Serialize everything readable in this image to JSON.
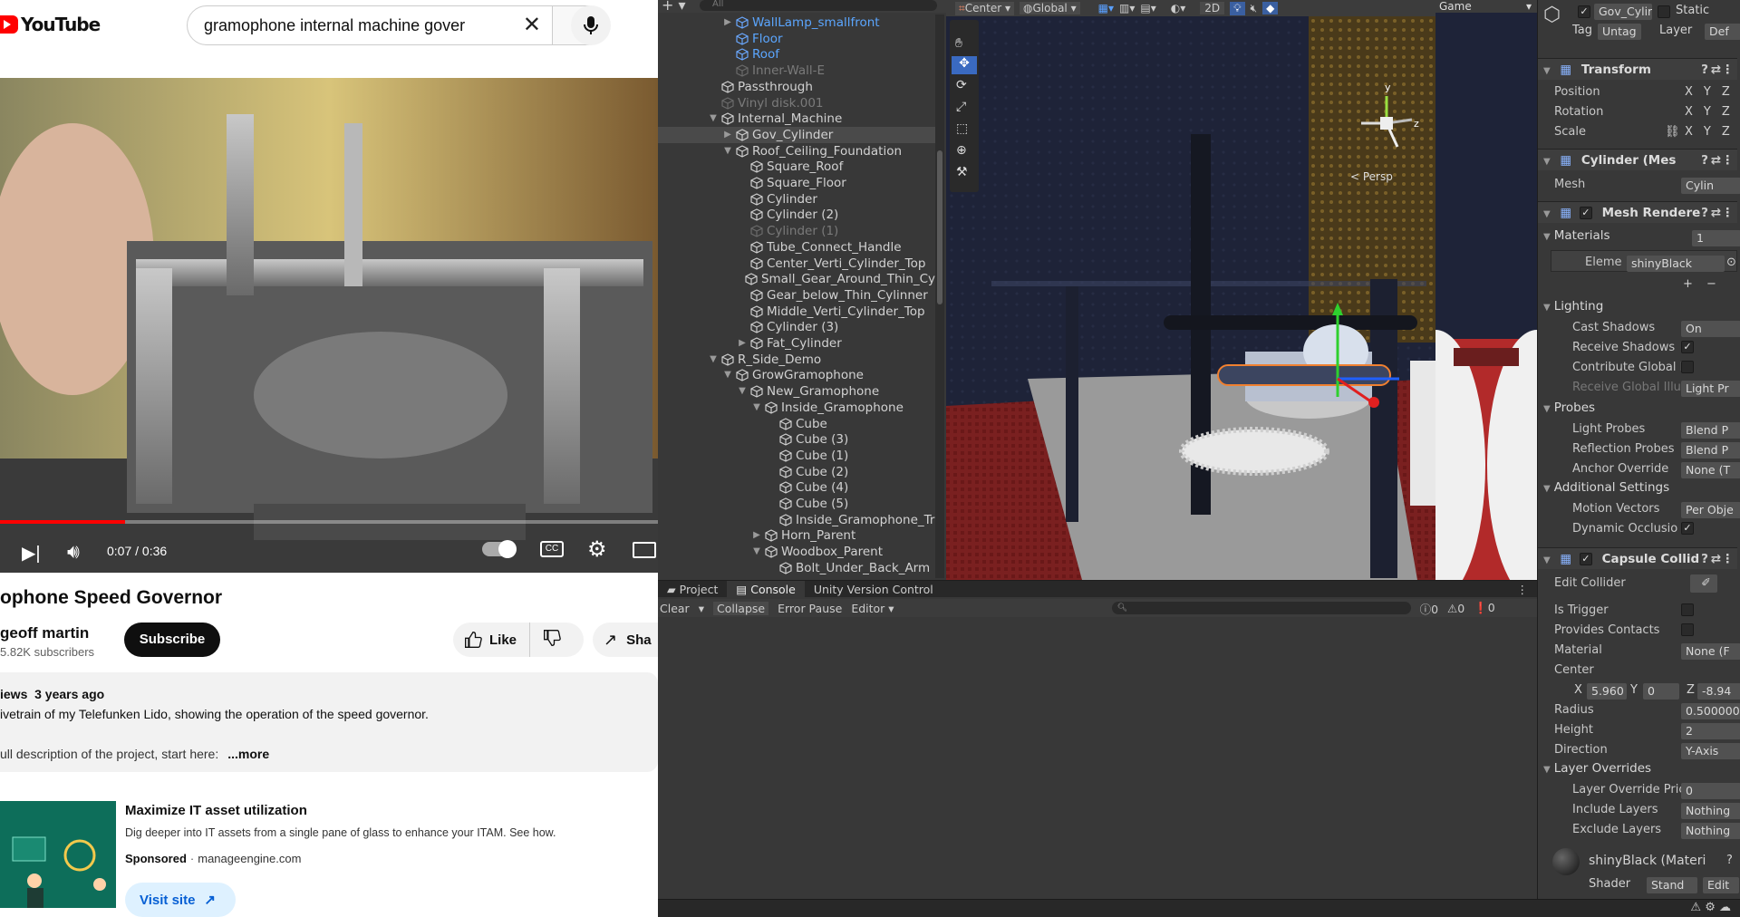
{
  "youtube": {
    "logo": "YouTube",
    "search_value": "gramophone internal machine gover",
    "player": {
      "time": "0:07 / 0:36",
      "progress": 0.19
    },
    "title": "ophone Speed Governor",
    "channel": "geoff martin",
    "subscribers": "5.82K subscribers",
    "subscribe": "Subscribe",
    "like": "Like",
    "share": "Sha",
    "desc_meta": "iews  3 years ago",
    "desc_line1": "ivetrain of my Telefunken Lido, showing the operation of the speed governor.",
    "desc_line2": "ull description of the project, start here:",
    "more": "...more",
    "ad": {
      "title": "Maximize IT asset utilization",
      "text": "Dig deeper into IT assets from a single pane of glass to enhance your ITAM. See how.",
      "sponsored": "Sponsored",
      "domain": "manageengine.com",
      "cta": "Visit site"
    }
  },
  "unity": {
    "hierarchy": {
      "search_placeholder": "All",
      "items": [
        {
          "label": "WallLamp_smallfront",
          "cls": "blue",
          "indent": 5,
          "arrow": "▶"
        },
        {
          "label": "Floor",
          "cls": "blue",
          "indent": 5,
          "arrow": ""
        },
        {
          "label": "Roof",
          "cls": "blue",
          "indent": 5,
          "arrow": ""
        },
        {
          "label": "Inner-Wall-E",
          "cls": "dis",
          "indent": 5,
          "arrow": ""
        },
        {
          "label": "Passthrough",
          "cls": "",
          "indent": 4,
          "arrow": ""
        },
        {
          "label": "Vinyl disk.001",
          "cls": "dis",
          "indent": 4,
          "arrow": ""
        },
        {
          "label": "Internal_Machine",
          "cls": "",
          "indent": 4,
          "arrow": "▼"
        },
        {
          "label": "Gov_Cylinder",
          "cls": "",
          "indent": 5,
          "arrow": "▶",
          "sel": true
        },
        {
          "label": "Roof_Ceiling_Foundation",
          "cls": "",
          "indent": 5,
          "arrow": "▼"
        },
        {
          "label": "Square_Roof",
          "cls": "",
          "indent": 6,
          "arrow": ""
        },
        {
          "label": "Square_Floor",
          "cls": "",
          "indent": 6,
          "arrow": ""
        },
        {
          "label": "Cylinder",
          "cls": "",
          "indent": 6,
          "arrow": ""
        },
        {
          "label": "Cylinder (2)",
          "cls": "",
          "indent": 6,
          "arrow": ""
        },
        {
          "label": "Cylinder (1)",
          "cls": "dis",
          "indent": 6,
          "arrow": ""
        },
        {
          "label": "Tube_Connect_Handle",
          "cls": "",
          "indent": 6,
          "arrow": ""
        },
        {
          "label": "Center_Verti_Cylinder_Top",
          "cls": "",
          "indent": 6,
          "arrow": ""
        },
        {
          "label": "Small_Gear_Around_Thin_Cy",
          "cls": "",
          "indent": 6,
          "arrow": ""
        },
        {
          "label": "Gear_below_Thin_Cylinner",
          "cls": "",
          "indent": 6,
          "arrow": ""
        },
        {
          "label": "Middle_Verti_Cylinder_Top",
          "cls": "",
          "indent": 6,
          "arrow": ""
        },
        {
          "label": "Cylinder (3)",
          "cls": "",
          "indent": 6,
          "arrow": ""
        },
        {
          "label": "Fat_Cylinder",
          "cls": "",
          "indent": 6,
          "arrow": "▶"
        },
        {
          "label": "R_Side_Demo",
          "cls": "",
          "indent": 4,
          "arrow": "▼"
        },
        {
          "label": "GrowGramophone",
          "cls": "",
          "indent": 5,
          "arrow": "▼"
        },
        {
          "label": "New_Gramophone",
          "cls": "",
          "indent": 6,
          "arrow": "▼"
        },
        {
          "label": "Inside_Gramophone",
          "cls": "",
          "indent": 7,
          "arrow": "▼"
        },
        {
          "label": "Cube",
          "cls": "",
          "indent": 8,
          "arrow": ""
        },
        {
          "label": "Cube (3)",
          "cls": "",
          "indent": 8,
          "arrow": ""
        },
        {
          "label": "Cube (1)",
          "cls": "",
          "indent": 8,
          "arrow": ""
        },
        {
          "label": "Cube (2)",
          "cls": "",
          "indent": 8,
          "arrow": ""
        },
        {
          "label": "Cube (4)",
          "cls": "",
          "indent": 8,
          "arrow": ""
        },
        {
          "label": "Cube (5)",
          "cls": "",
          "indent": 8,
          "arrow": ""
        },
        {
          "label": "Inside_Gramophone_Tr",
          "cls": "",
          "indent": 8,
          "arrow": ""
        },
        {
          "label": "Horn_Parent",
          "cls": "",
          "indent": 7,
          "arrow": "▶"
        },
        {
          "label": "Woodbox_Parent",
          "cls": "",
          "indent": 7,
          "arrow": "▼"
        },
        {
          "label": "Bolt_Under_Back_Arm",
          "cls": "",
          "indent": 8,
          "arrow": ""
        }
      ]
    },
    "scene_toolbar": {
      "pivot": "Center",
      "space": "Global",
      "mode2d": "2D",
      "persp": "< Persp",
      "y_axis": "y",
      "z_axis": "z"
    },
    "game_tab": "Game",
    "bottom": {
      "tabs": [
        "Project",
        "Console",
        "Unity Version Control"
      ],
      "clear": "Clear",
      "collapse": "Collapse",
      "error_pause": "Error Pause",
      "editor": "Editor",
      "counts": [
        "0",
        "0",
        "0"
      ]
    },
    "inspector": {
      "name": "Gov_Cylir",
      "static": "Static",
      "tag_label": "Tag",
      "tag_value": "Untag",
      "layer_label": "Layer",
      "layer_value": "Def",
      "transform": "Transform",
      "position": "Position",
      "rotation": "Rotation",
      "scale": "Scale",
      "x": "X",
      "y": "Y",
      "z": "Z",
      "mesh_filter": "Cylinder (Mes",
      "mesh_label": "Mesh",
      "mesh_value": "Cylin",
      "mesh_renderer": "Mesh Rendere",
      "materials": "Materials",
      "materials_count": "1",
      "element_label": "Eleme",
      "element_value": "shinyBlack",
      "plus": "+",
      "minus": "−",
      "lighting": "Lighting",
      "cast_shadows": "Cast Shadows",
      "cast_shadows_val": "On",
      "receive_shadows": "Receive Shadows",
      "contribute_gi": "Contribute Global I",
      "receive_gi": "Receive Global Illu",
      "receive_gi_val": "Light Pr",
      "probes": "Probes",
      "light_probes": "Light Probes",
      "light_probes_val": "Blend P",
      "reflection_probes": "Reflection Probes",
      "reflection_probes_val": "Blend P",
      "anchor_override": "Anchor Override",
      "anchor_override_val": "None (T",
      "additional": "Additional Settings",
      "motion_vectors": "Motion Vectors",
      "motion_vectors_val": "Per Obje",
      "dynamic_occlusion": "Dynamic Occlusio",
      "capsule": "Capsule Collid",
      "edit_collider": "Edit Collider",
      "is_trigger": "Is Trigger",
      "provides_contacts": "Provides Contacts",
      "material": "Material",
      "material_val": "None (F",
      "center": "Center",
      "center_x": "5.960",
      "center_y": "0",
      "center_z": "-8.94",
      "radius": "Radius",
      "radius_val": "0.500000",
      "height": "Height",
      "height_val": "2",
      "direction": "Direction",
      "direction_val": "Y-Axis",
      "layer_overrides": "Layer Overrides",
      "layer_override_priority": "Layer Override Pric",
      "layer_override_priority_val": "0",
      "include_layers": "Include Layers",
      "include_layers_val": "Nothing",
      "exclude_layers": "Exclude Layers",
      "exclude_layers_val": "Nothing",
      "mat_preview": "shinyBlack (Materi",
      "shader": "Shader",
      "shader_val": "Stand",
      "edit": "Edit"
    }
  }
}
